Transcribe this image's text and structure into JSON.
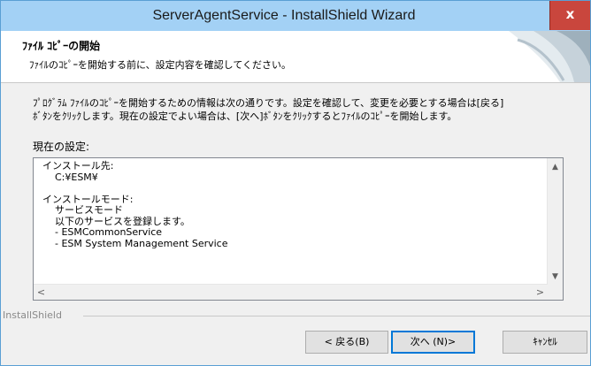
{
  "window": {
    "title": "ServerAgentService - InstallShield Wizard",
    "close_label": "x"
  },
  "header": {
    "title": "ﾌｧｲﾙ ｺﾋﾟｰの開始",
    "subtitle": "ﾌｧｲﾙのｺﾋﾟｰを開始する前に、設定内容を確認してください。"
  },
  "description": {
    "line1": "ﾌﾟﾛｸﾞﾗﾑ ﾌｧｲﾙのｺﾋﾟｰを開始するための情報は次の通りです。設定を確認して、変更を必要とする場合は[戻る]",
    "line2": "ﾎﾞﾀﾝをｸﾘｯｸします。現在の設定でよい場合は、[次へ]ﾎﾞﾀﾝをｸﾘｯｸするとﾌｧｲﾙのｺﾋﾟｰを開始します。"
  },
  "settings": {
    "label": "現在の設定:",
    "content": "インストール先:\n    C:¥ESM¥\n\nインストールモード:\n    サービスモード\n    以下のサービスを登録します。\n    - ESMCommonService\n    - ESM System Management Service"
  },
  "footer": {
    "brand": "InstallShield",
    "back_label": "< 戻る(B)",
    "next_label": "次へ (N)>",
    "cancel_label": "ｷｬﾝｾﾙ"
  },
  "colors": {
    "titlebar": "#a3d1f5",
    "close_button": "#c9463d",
    "default_button_border": "#0078d7"
  }
}
